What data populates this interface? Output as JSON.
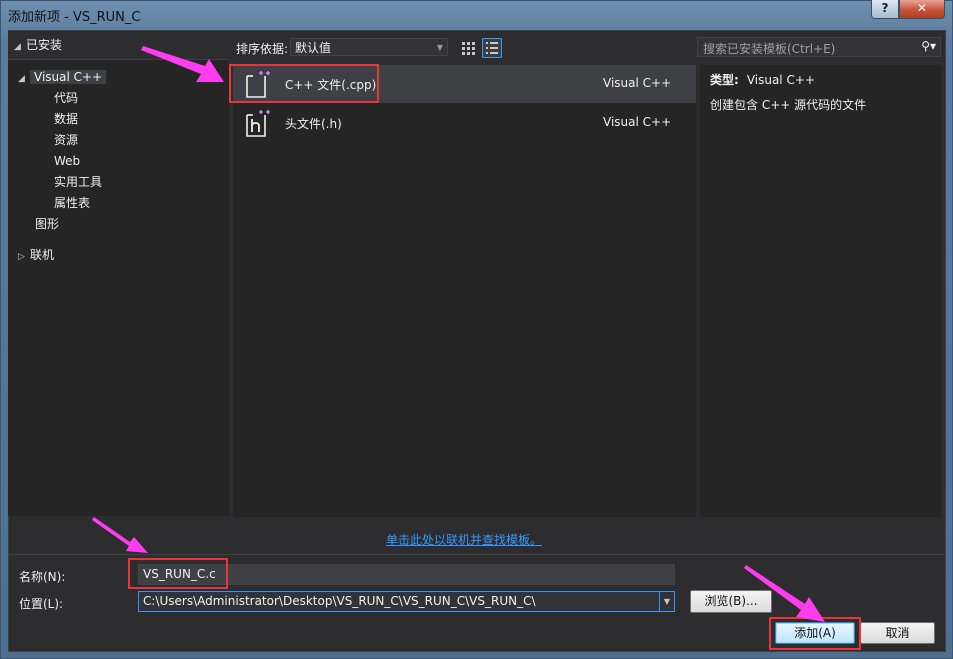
{
  "window": {
    "title": "添加新项 - VS_RUN_C",
    "help_glyph": "?",
    "close_glyph": "✕"
  },
  "tree": {
    "header": "已安装",
    "root": "Visual C++",
    "children": [
      "代码",
      "数据",
      "资源",
      "Web",
      "实用工具",
      "属性表"
    ],
    "graphics": "图形",
    "online": "联机"
  },
  "toolbar": {
    "sort_label": "排序依据:",
    "sort_value": "默认值"
  },
  "search": {
    "placeholder": "搜索已安装模板(Ctrl+E)"
  },
  "templates": [
    {
      "name": "C++ 文件(.cpp)",
      "lang": "Visual C++"
    },
    {
      "name": "头文件(.h)",
      "lang": "Visual C++"
    }
  ],
  "details": {
    "type_label": "类型:",
    "type_value": "Visual C++",
    "description": "创建包含 C++ 源代码的文件"
  },
  "online_link": "单击此处以联机并查找模板。",
  "form": {
    "name_label": "名称(N):",
    "name_value": "VS_RUN_C.c",
    "location_label": "位置(L):",
    "location_value": "C:\\Users\\Administrator\\Desktop\\VS_RUN_C\\VS_RUN_C\\VS_RUN_C\\",
    "browse_label": "浏览(B)...",
    "add_label": "添加(A)",
    "cancel_label": "取消"
  },
  "colors": {
    "background": "#2d2d30",
    "panel": "#252526",
    "selection": "#3f3f46",
    "link": "#3399ff",
    "highlight": "#e8343a",
    "annotation_arrow": "#ff3cf0"
  }
}
